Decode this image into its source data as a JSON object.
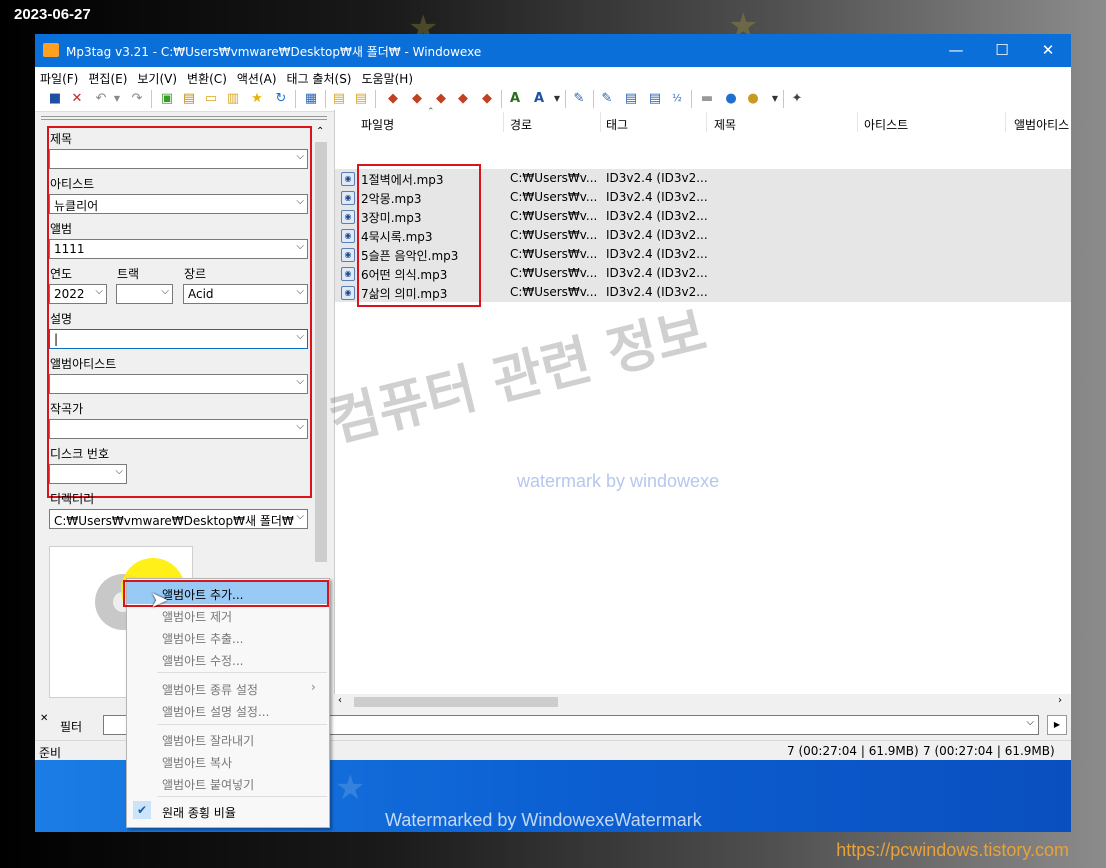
{
  "overlay": {
    "date": "2023-06-27",
    "site_url": "https://pcwindows.tistory.com",
    "watermark_korean": "컴퓨터 관련 정보",
    "watermark_english": "watermark by windowexe",
    "watermark_bottom": "Watermarked by WindowexeWatermark"
  },
  "window": {
    "title": "Mp3tag v3.21  -  C:₩Users₩vmware₩Desktop₩새 폴더₩  - Windowexe",
    "minimize": "—",
    "maximize": "☐",
    "close": "✕"
  },
  "menu": [
    "파일(F)",
    "편집(E)",
    "보기(V)",
    "변환(C)",
    "액션(A)",
    "태그 출처(S)",
    "도움말(H)"
  ],
  "tag_panel": {
    "title_label": "제목",
    "title_value": "",
    "artist_label": "아티스트",
    "artist_value": "뉴클리어",
    "album_label": "앨범",
    "album_value": "1111",
    "year_label": "연도",
    "year_value": "2022",
    "track_label": "트랙",
    "track_value": "",
    "genre_label": "장르",
    "genre_value": "Acid",
    "comment_label": "설명",
    "comment_value": "|",
    "album_artist_label": "앨범아티스트",
    "album_artist_value": "",
    "composer_label": "작곡가",
    "composer_value": "",
    "disc_label": "디스크 번호",
    "disc_value": "",
    "directory_label": "디렉터리",
    "directory_value": "C:₩Users₩vmware₩Desktop₩새 폴더₩"
  },
  "file_list": {
    "columns": [
      "파일명",
      "경로",
      "태그",
      "제목",
      "아티스트",
      "앨범아티스"
    ],
    "rows": [
      {
        "filename": "1절벽에서.mp3",
        "path": "C:₩Users₩v...",
        "tag": "ID3v2.4 (ID3v2..."
      },
      {
        "filename": "2악몽.mp3",
        "path": "C:₩Users₩v...",
        "tag": "ID3v2.4 (ID3v2..."
      },
      {
        "filename": "3장미.mp3",
        "path": "C:₩Users₩v...",
        "tag": "ID3v2.4 (ID3v2..."
      },
      {
        "filename": "4묵시록.mp3",
        "path": "C:₩Users₩v...",
        "tag": "ID3v2.4 (ID3v2..."
      },
      {
        "filename": "5슬픈 음악인.mp3",
        "path": "C:₩Users₩v...",
        "tag": "ID3v2.4 (ID3v2..."
      },
      {
        "filename": "6어떤 의식.mp3",
        "path": "C:₩Users₩v...",
        "tag": "ID3v2.4 (ID3v2..."
      },
      {
        "filename": "7삶의 의미.mp3",
        "path": "C:₩Users₩v...",
        "tag": "ID3v2.4 (ID3v2..."
      }
    ]
  },
  "filter": {
    "label": "필터",
    "value": ""
  },
  "status": {
    "ready": "준비",
    "selected": "7 (00:27:04 | 61.9MB)",
    "total": "7 (00:27:04 | 61.9MB)"
  },
  "context_menu": {
    "items": [
      "앨범아트 추가...",
      "앨범아트 제거",
      "앨범아트 추출...",
      "앨범아트 수정...",
      "앨범아트 종류 설정",
      "앨범아트 설명 설정...",
      "앨범아트 잘라내기",
      "앨범아트 복사",
      "앨범아트 붙여넣기",
      "원래 종횡 비율"
    ],
    "submenu_arrow": "›",
    "check": "✔"
  },
  "colors": {
    "titlebar": "#0a6fd8",
    "highlight_box": "#d9141d",
    "menu_hover": "#99c9f5"
  }
}
